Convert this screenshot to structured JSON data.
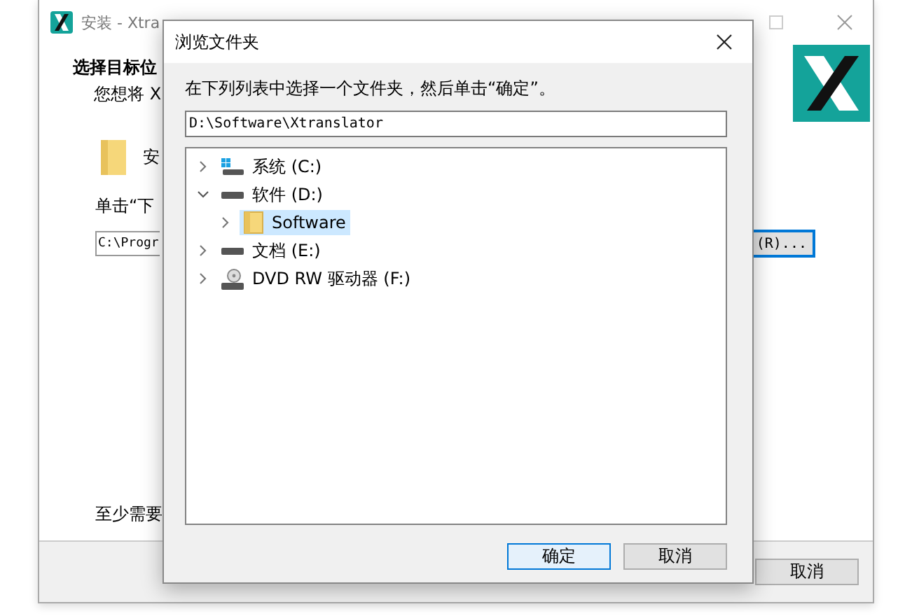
{
  "installer": {
    "title": "安装 - Xtra",
    "heading": "选择目标位",
    "subheading": "您想将 X",
    "folder_label": "安",
    "instruction": "单击“下",
    "path_value": "C:\\Progr",
    "browse_button": "(R)...",
    "space_note": "至少需要",
    "cancel_button": "取消"
  },
  "dialog": {
    "title": "浏览文件夹",
    "instruction": "在下列列表中选择一个文件夹，然后单击“确定”。",
    "path_value": "D:\\Software\\Xtranslator",
    "tree": [
      {
        "label": "系统 (C:)",
        "kind": "system-drive",
        "expanded": false,
        "selected": false
      },
      {
        "label": "软件 (D:)",
        "kind": "drive",
        "expanded": true,
        "selected": false,
        "children": [
          {
            "label": "Software",
            "kind": "folder",
            "expanded": false,
            "selected": true
          }
        ]
      },
      {
        "label": "文档 (E:)",
        "kind": "drive",
        "expanded": false,
        "selected": false
      },
      {
        "label": "DVD RW 驱动器 (F:)",
        "kind": "dvd",
        "expanded": false,
        "selected": false
      }
    ],
    "buttons": [
      {
        "label": "确定",
        "default": true
      },
      {
        "label": "取消",
        "default": false
      }
    ]
  }
}
